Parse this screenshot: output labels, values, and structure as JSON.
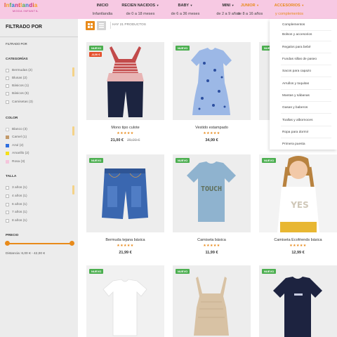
{
  "brand": {
    "logo_letters": [
      "I",
      "n",
      "f",
      "a",
      "n",
      "t",
      "l",
      "a",
      "n",
      "d",
      "i",
      "a"
    ],
    "logo_colors": [
      "#e5502c",
      "#f4a11d",
      "#4caf50",
      "#2f7fd0",
      "#c0308a",
      "#e5502c",
      "#f4a11d",
      "#4caf50",
      "#2f7fd0",
      "#c0308a",
      "#e5502c",
      "#f4a11d"
    ],
    "logo_sub": "MODA INFANTIL"
  },
  "nav": [
    {
      "label": "INICIO",
      "sub": "Infantlandia",
      "has_chevron": false
    },
    {
      "label": "RECIEN NACIDOS",
      "sub": "de 0 a 18 meses",
      "has_chevron": true
    },
    {
      "label": "BABY",
      "sub": "de 6 a 36 meses",
      "has_chevron": true
    },
    {
      "label": "MINI",
      "sub": "de 2 a 9 años",
      "has_chevron": true
    },
    {
      "label": "JUNIOR",
      "sub": "de 8 a 16 años",
      "has_chevron": true
    },
    {
      "label": "ACCESORIOS",
      "sub": "y complementos",
      "has_chevron": true
    }
  ],
  "sidebar": {
    "title": "FILTRADO POR",
    "filter_by": "FILTRADO POR",
    "categories_label": "CATEGORÍAS",
    "categories": [
      "Bermudas (2)",
      "Blusas (2)",
      "Básicos (1)",
      "Básicos (5)",
      "Camisetas (3)"
    ],
    "color_label": "COLOR",
    "colors": [
      {
        "label": "Blanco (3)",
        "swatch": "#ffffff"
      },
      {
        "label": "Camel (1)",
        "swatch": "#c39a6b"
      },
      {
        "label": "Azul (2)",
        "swatch": "#2f6fe0"
      },
      {
        "label": "Amarillo (2)",
        "swatch": "#f5e01a"
      },
      {
        "label": "Rosa (3)",
        "swatch": "#f5c6dc"
      }
    ],
    "size_label": "TALLA",
    "sizes": [
      "3 años (1)",
      "4 años (1)",
      "6 años (1)",
      "7 años (1)",
      "8 años (1)"
    ],
    "price_label": "PRECIO",
    "price_range": "Distancia: 6,00 € - 42,00 €"
  },
  "toolbar": {
    "count": "HAY 21 PRODUCTOS"
  },
  "products": [
    {
      "name": "Mono tipo culote",
      "stars": "★★★★★",
      "price": "21,00 €",
      "old_price": "29,00 €",
      "badge": "NUEVO",
      "discount": "-8,00 €"
    },
    {
      "name": "Vestido estampado",
      "stars": "★★★★★",
      "price": "34,99 €",
      "old_price": "",
      "badge": "NUEVO",
      "discount": ""
    },
    {
      "name": "",
      "stars": "",
      "price": "",
      "old_price": "",
      "badge": "NUEVO",
      "discount": ""
    },
    {
      "name": "Bermuda tejana básica",
      "stars": "★★★★★",
      "price": "21,99 €",
      "old_price": "",
      "badge": "NUEVO",
      "discount": ""
    },
    {
      "name": "Camiseta básica",
      "stars": "★★★★★",
      "price": "11,99 €",
      "old_price": "",
      "badge": "NUEVO",
      "discount": ""
    },
    {
      "name": "Camiseta Ecofriends básica",
      "stars": "★★★★★",
      "price": "12,99 €",
      "old_price": "",
      "badge": "NUEVO",
      "discount": ""
    },
    {
      "name": "",
      "stars": "",
      "price": "",
      "old_price": "",
      "badge": "NUEVO",
      "discount": ""
    },
    {
      "name": "",
      "stars": "",
      "price": "",
      "old_price": "",
      "badge": "NUEVO",
      "discount": ""
    },
    {
      "name": "",
      "stars": "",
      "price": "",
      "old_price": "",
      "badge": "NUEVO",
      "discount": ""
    }
  ],
  "tshirt_print": "TOUCH",
  "tee_print": "YES",
  "dropdown": [
    "Complementos",
    "Bolsos y accesorios",
    "Regalos para bebé",
    "Fundas sillas de paseo",
    "Sacos para capazo",
    "Arrullos y toquitas",
    "Mantas y sábanas",
    "Gasas y baberos",
    "Toallas y albornoces",
    "Ropa para dormir",
    "Primera puesta"
  ],
  "colors": {
    "accent": "#e88a1a",
    "header_bg": "#f7c9e3",
    "badge_new": "#4caf50",
    "badge_discount": "#e5502c",
    "sidebar_bg": "#ececec"
  }
}
